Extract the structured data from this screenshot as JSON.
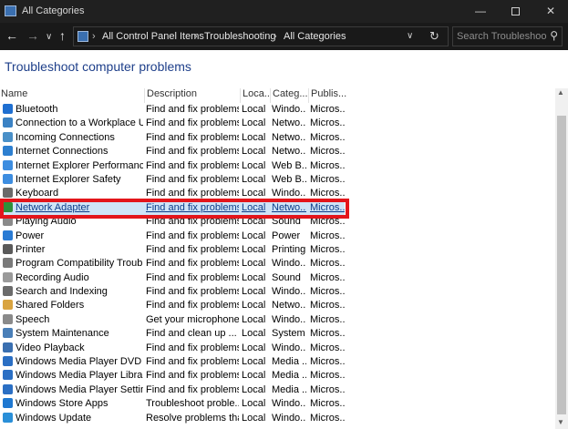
{
  "window": {
    "title": "All Categories",
    "min_glyph": "—",
    "close_glyph": "✕"
  },
  "nav": {
    "back_glyph": "←",
    "forward_glyph": "→",
    "recent_glyph": "∨",
    "up_glyph": "↑",
    "breadcrumbs": [
      "All Control Panel Items",
      "Troubleshooting",
      "All Categories"
    ],
    "crumb_sep": "›",
    "dropdown_glyph": "∨",
    "refresh_glyph": "↻",
    "search_placeholder": "Search Troubleshooti...",
    "search_glyph": "⚲"
  },
  "page_title": "Troubleshoot computer problems",
  "columns": [
    "Name",
    "Description",
    "Loca...",
    "Categ...",
    "Publis..."
  ],
  "rows": [
    {
      "name": "Bluetooth",
      "desc": "Find and fix problems...",
      "loc": "Local",
      "cat": "Windo...",
      "pub": "Micros...",
      "icon": "bluetooth-icon",
      "color": "#1f6fd1"
    },
    {
      "name": "Connection to a Workplace Usi...",
      "desc": "Find and fix problems...",
      "loc": "Local",
      "cat": "Netwo...",
      "pub": "Micros...",
      "icon": "workplace-connection-icon",
      "color": "#3b82c4"
    },
    {
      "name": "Incoming Connections",
      "desc": "Find and fix problems...",
      "loc": "Local",
      "cat": "Netwo...",
      "pub": "Micros...",
      "icon": "incoming-connections-icon",
      "color": "#4a90c8"
    },
    {
      "name": "Internet Connections",
      "desc": "Find and fix problems...",
      "loc": "Local",
      "cat": "Netwo...",
      "pub": "Micros...",
      "icon": "internet-connections-icon",
      "color": "#2d7fd0"
    },
    {
      "name": "Internet Explorer Performance",
      "desc": "Find and fix problems...",
      "loc": "Local",
      "cat": "Web B...",
      "pub": "Micros...",
      "icon": "ie-performance-icon",
      "color": "#3d8de0"
    },
    {
      "name": "Internet Explorer Safety",
      "desc": "Find and fix problems...",
      "loc": "Local",
      "cat": "Web B...",
      "pub": "Micros...",
      "icon": "ie-safety-icon",
      "color": "#3d8de0"
    },
    {
      "name": "Keyboard",
      "desc": "Find and fix problems...",
      "loc": "Local",
      "cat": "Windo...",
      "pub": "Micros...",
      "icon": "keyboard-icon",
      "color": "#6a6a6a"
    },
    {
      "name": "Network Adapter",
      "desc": "Find and fix problems...",
      "loc": "Local",
      "cat": "Netwo...",
      "pub": "Micros...",
      "icon": "network-adapter-icon",
      "color": "#2f8f3a",
      "selected": true
    },
    {
      "name": "Playing Audio",
      "desc": "Find and fix problems...",
      "loc": "Local",
      "cat": "Sound",
      "pub": "Micros...",
      "icon": "speaker-icon",
      "color": "#8a8a8a"
    },
    {
      "name": "Power",
      "desc": "Find and fix problems...",
      "loc": "Local",
      "cat": "Power",
      "pub": "Micros...",
      "icon": "power-icon",
      "color": "#2a7bd4"
    },
    {
      "name": "Printer",
      "desc": "Find and fix problems...",
      "loc": "Local",
      "cat": "Printing",
      "pub": "Micros...",
      "icon": "printer-icon",
      "color": "#5a5a5a"
    },
    {
      "name": "Program Compatibility Trouble...",
      "desc": "Find and fix problems...",
      "loc": "Local",
      "cat": "Windo...",
      "pub": "Micros...",
      "icon": "program-compatibility-icon",
      "color": "#7a7a7a"
    },
    {
      "name": "Recording Audio",
      "desc": "Find and fix problems...",
      "loc": "Local",
      "cat": "Sound",
      "pub": "Micros...",
      "icon": "microphone-icon",
      "color": "#9a9a9a"
    },
    {
      "name": "Search and Indexing",
      "desc": "Find and fix problems...",
      "loc": "Local",
      "cat": "Windo...",
      "pub": "Micros...",
      "icon": "search-indexing-icon",
      "color": "#6b6b6b"
    },
    {
      "name": "Shared Folders",
      "desc": "Find and fix problems...",
      "loc": "Local",
      "cat": "Netwo...",
      "pub": "Micros...",
      "icon": "shared-folders-icon",
      "color": "#d9a441"
    },
    {
      "name": "Speech",
      "desc": "Get your microphone ...",
      "loc": "Local",
      "cat": "Windo...",
      "pub": "Micros...",
      "icon": "speech-icon",
      "color": "#8a8a8a"
    },
    {
      "name": "System Maintenance",
      "desc": "Find and clean up ...",
      "loc": "Local",
      "cat": "System",
      "pub": "Micros...",
      "icon": "system-maintenance-icon",
      "color": "#4a7fb8"
    },
    {
      "name": "Video Playback",
      "desc": "Find and fix problems...",
      "loc": "Local",
      "cat": "Windo...",
      "pub": "Micros...",
      "icon": "video-playback-icon",
      "color": "#3a6fb0"
    },
    {
      "name": "Windows Media Player DVD",
      "desc": "Find and fix problems...",
      "loc": "Local",
      "cat": "Media ...",
      "pub": "Micros...",
      "icon": "media-player-dvd-icon",
      "color": "#2b6fc4"
    },
    {
      "name": "Windows Media Player Library",
      "desc": "Find and fix problems...",
      "loc": "Local",
      "cat": "Media ...",
      "pub": "Micros...",
      "icon": "media-player-library-icon",
      "color": "#2b6fc4"
    },
    {
      "name": "Windows Media Player Settings",
      "desc": "Find and fix problems...",
      "loc": "Local",
      "cat": "Media ...",
      "pub": "Micros...",
      "icon": "media-player-settings-icon",
      "color": "#2b6fc4"
    },
    {
      "name": "Windows Store Apps",
      "desc": "Troubleshoot proble...",
      "loc": "Local",
      "cat": "Windo...",
      "pub": "Micros...",
      "icon": "store-apps-icon",
      "color": "#1f78d1"
    },
    {
      "name": "Windows Update",
      "desc": "Resolve problems tha...",
      "loc": "Local",
      "cat": "Windo...",
      "pub": "Micros...",
      "icon": "windows-update-icon",
      "color": "#2a8fd8"
    }
  ],
  "scrollbar": {
    "up_glyph": "▲",
    "down_glyph": "▼"
  },
  "colors": {
    "highlight": "#e3151b",
    "selection": "#cfe4f7",
    "title": "#1e3f8a"
  }
}
